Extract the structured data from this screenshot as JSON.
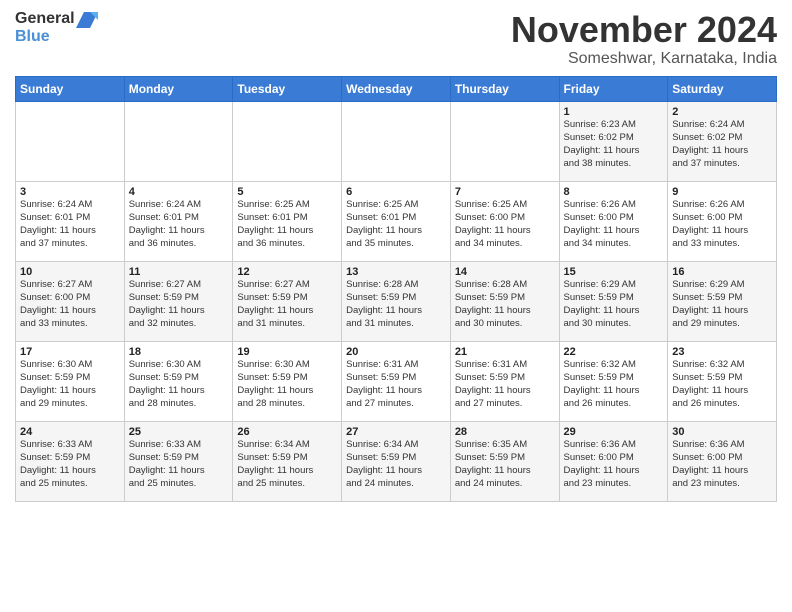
{
  "header": {
    "logo_general": "General",
    "logo_blue": "Blue",
    "month_title": "November 2024",
    "location": "Someshwar, Karnataka, India"
  },
  "weekdays": [
    "Sunday",
    "Monday",
    "Tuesday",
    "Wednesday",
    "Thursday",
    "Friday",
    "Saturday"
  ],
  "weeks": [
    [
      {
        "day": "",
        "info": ""
      },
      {
        "day": "",
        "info": ""
      },
      {
        "day": "",
        "info": ""
      },
      {
        "day": "",
        "info": ""
      },
      {
        "day": "",
        "info": ""
      },
      {
        "day": "1",
        "info": "Sunrise: 6:23 AM\nSunset: 6:02 PM\nDaylight: 11 hours\nand 38 minutes."
      },
      {
        "day": "2",
        "info": "Sunrise: 6:24 AM\nSunset: 6:02 PM\nDaylight: 11 hours\nand 37 minutes."
      }
    ],
    [
      {
        "day": "3",
        "info": "Sunrise: 6:24 AM\nSunset: 6:01 PM\nDaylight: 11 hours\nand 37 minutes."
      },
      {
        "day": "4",
        "info": "Sunrise: 6:24 AM\nSunset: 6:01 PM\nDaylight: 11 hours\nand 36 minutes."
      },
      {
        "day": "5",
        "info": "Sunrise: 6:25 AM\nSunset: 6:01 PM\nDaylight: 11 hours\nand 36 minutes."
      },
      {
        "day": "6",
        "info": "Sunrise: 6:25 AM\nSunset: 6:01 PM\nDaylight: 11 hours\nand 35 minutes."
      },
      {
        "day": "7",
        "info": "Sunrise: 6:25 AM\nSunset: 6:00 PM\nDaylight: 11 hours\nand 34 minutes."
      },
      {
        "day": "8",
        "info": "Sunrise: 6:26 AM\nSunset: 6:00 PM\nDaylight: 11 hours\nand 34 minutes."
      },
      {
        "day": "9",
        "info": "Sunrise: 6:26 AM\nSunset: 6:00 PM\nDaylight: 11 hours\nand 33 minutes."
      }
    ],
    [
      {
        "day": "10",
        "info": "Sunrise: 6:27 AM\nSunset: 6:00 PM\nDaylight: 11 hours\nand 33 minutes."
      },
      {
        "day": "11",
        "info": "Sunrise: 6:27 AM\nSunset: 5:59 PM\nDaylight: 11 hours\nand 32 minutes."
      },
      {
        "day": "12",
        "info": "Sunrise: 6:27 AM\nSunset: 5:59 PM\nDaylight: 11 hours\nand 31 minutes."
      },
      {
        "day": "13",
        "info": "Sunrise: 6:28 AM\nSunset: 5:59 PM\nDaylight: 11 hours\nand 31 minutes."
      },
      {
        "day": "14",
        "info": "Sunrise: 6:28 AM\nSunset: 5:59 PM\nDaylight: 11 hours\nand 30 minutes."
      },
      {
        "day": "15",
        "info": "Sunrise: 6:29 AM\nSunset: 5:59 PM\nDaylight: 11 hours\nand 30 minutes."
      },
      {
        "day": "16",
        "info": "Sunrise: 6:29 AM\nSunset: 5:59 PM\nDaylight: 11 hours\nand 29 minutes."
      }
    ],
    [
      {
        "day": "17",
        "info": "Sunrise: 6:30 AM\nSunset: 5:59 PM\nDaylight: 11 hours\nand 29 minutes."
      },
      {
        "day": "18",
        "info": "Sunrise: 6:30 AM\nSunset: 5:59 PM\nDaylight: 11 hours\nand 28 minutes."
      },
      {
        "day": "19",
        "info": "Sunrise: 6:30 AM\nSunset: 5:59 PM\nDaylight: 11 hours\nand 28 minutes."
      },
      {
        "day": "20",
        "info": "Sunrise: 6:31 AM\nSunset: 5:59 PM\nDaylight: 11 hours\nand 27 minutes."
      },
      {
        "day": "21",
        "info": "Sunrise: 6:31 AM\nSunset: 5:59 PM\nDaylight: 11 hours\nand 27 minutes."
      },
      {
        "day": "22",
        "info": "Sunrise: 6:32 AM\nSunset: 5:59 PM\nDaylight: 11 hours\nand 26 minutes."
      },
      {
        "day": "23",
        "info": "Sunrise: 6:32 AM\nSunset: 5:59 PM\nDaylight: 11 hours\nand 26 minutes."
      }
    ],
    [
      {
        "day": "24",
        "info": "Sunrise: 6:33 AM\nSunset: 5:59 PM\nDaylight: 11 hours\nand 25 minutes."
      },
      {
        "day": "25",
        "info": "Sunrise: 6:33 AM\nSunset: 5:59 PM\nDaylight: 11 hours\nand 25 minutes."
      },
      {
        "day": "26",
        "info": "Sunrise: 6:34 AM\nSunset: 5:59 PM\nDaylight: 11 hours\nand 25 minutes."
      },
      {
        "day": "27",
        "info": "Sunrise: 6:34 AM\nSunset: 5:59 PM\nDaylight: 11 hours\nand 24 minutes."
      },
      {
        "day": "28",
        "info": "Sunrise: 6:35 AM\nSunset: 5:59 PM\nDaylight: 11 hours\nand 24 minutes."
      },
      {
        "day": "29",
        "info": "Sunrise: 6:36 AM\nSunset: 6:00 PM\nDaylight: 11 hours\nand 23 minutes."
      },
      {
        "day": "30",
        "info": "Sunrise: 6:36 AM\nSunset: 6:00 PM\nDaylight: 11 hours\nand 23 minutes."
      }
    ]
  ]
}
